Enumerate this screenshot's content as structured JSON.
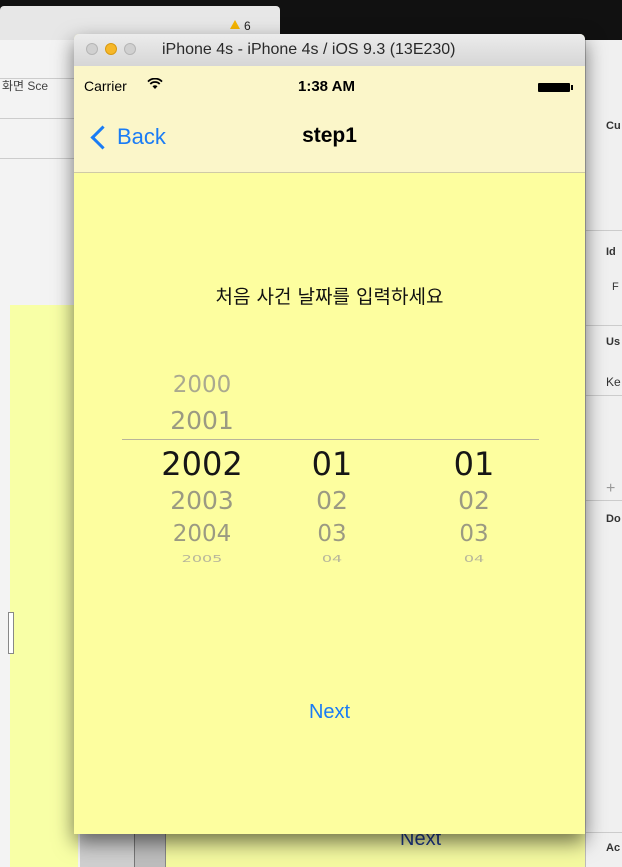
{
  "xcode": {
    "warning_count": "6",
    "scene_label": "화면 Sce",
    "bg_next_label": "Next",
    "right_labels": [
      "Cu",
      "Id",
      "F",
      "Us",
      "Ke",
      "+",
      "Do",
      "Ac"
    ]
  },
  "simulator": {
    "title": "iPhone 4s - iPhone 4s / iOS 9.3 (13E230)"
  },
  "status_bar": {
    "carrier": "Carrier",
    "time": "1:38 AM"
  },
  "nav": {
    "back_label": "Back",
    "title": "step1"
  },
  "content": {
    "prompt": "처음 사건 날짜를 입력하세요",
    "next_label": "Next"
  },
  "picker": {
    "years": [
      "2000",
      "2001",
      "2002",
      "2003",
      "2004",
      "2005"
    ],
    "months": [
      "01",
      "02",
      "03",
      "04"
    ],
    "days": [
      "01",
      "02",
      "03",
      "04"
    ],
    "selected": {
      "year": "2002",
      "month": "01",
      "day": "01"
    }
  },
  "colors": {
    "tint": "#1a7cf5",
    "background": "#fdfe9f",
    "nav_bar": "#fbf6c9"
  }
}
